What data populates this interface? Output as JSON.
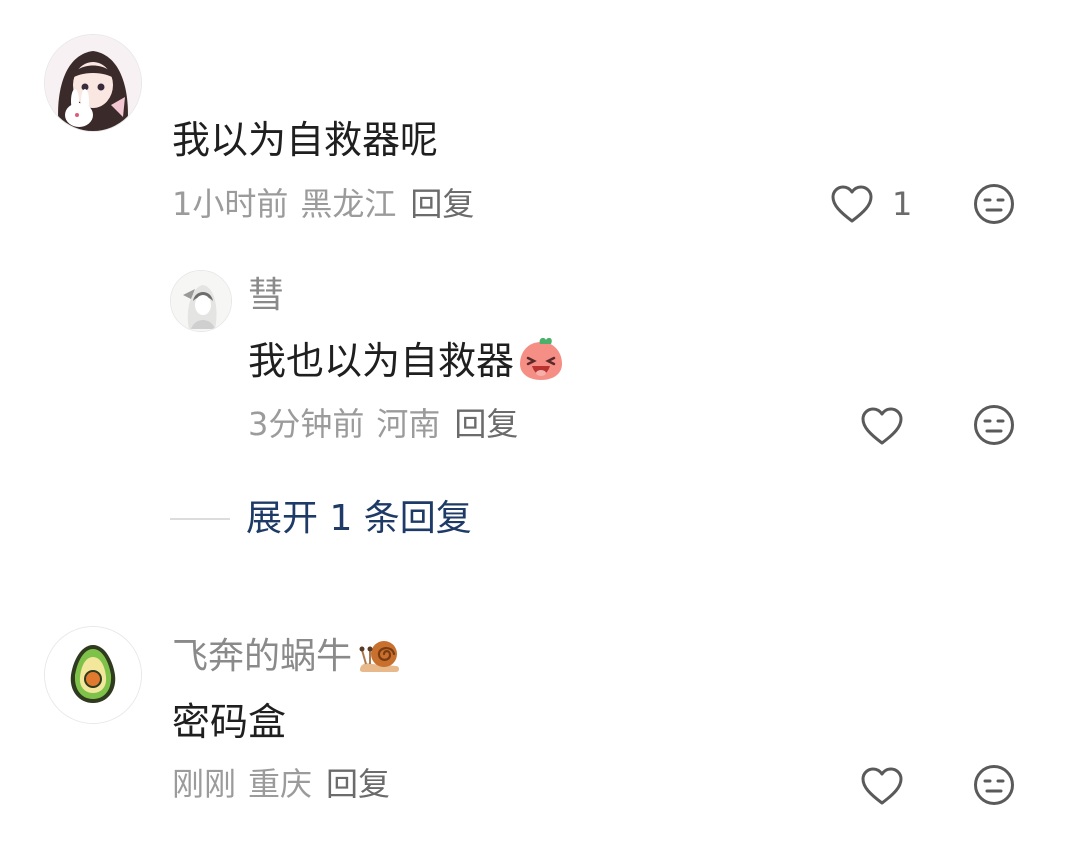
{
  "comments": [
    {
      "avatar": "anime-girl-avatar",
      "username": "",
      "content": "我以为自救器呢",
      "time": "1小时前",
      "region": "黑龙江",
      "reply_label": "回复",
      "like_count": "1",
      "replies": [
        {
          "avatar": "ink-sketch-avatar",
          "username": "彗",
          "content": "我也以为自救器",
          "content_emoji": "laughing-face-emoji",
          "time": "3分钟前",
          "region": "河南",
          "reply_label": "回复"
        }
      ],
      "expand_label": "展开 1 条回复"
    },
    {
      "avatar": "avocado-avatar",
      "username": "飞奔的蜗牛",
      "username_emoji": "snail-emoji",
      "content": "密码盒",
      "time": "刚刚",
      "region": "重庆",
      "reply_label": "回复"
    }
  ],
  "colors": {
    "meta_text": "#9b9b9b",
    "content_text": "#1f1f1f",
    "expand_link": "#1e3a66",
    "icon_stroke": "#5a5a5a"
  }
}
